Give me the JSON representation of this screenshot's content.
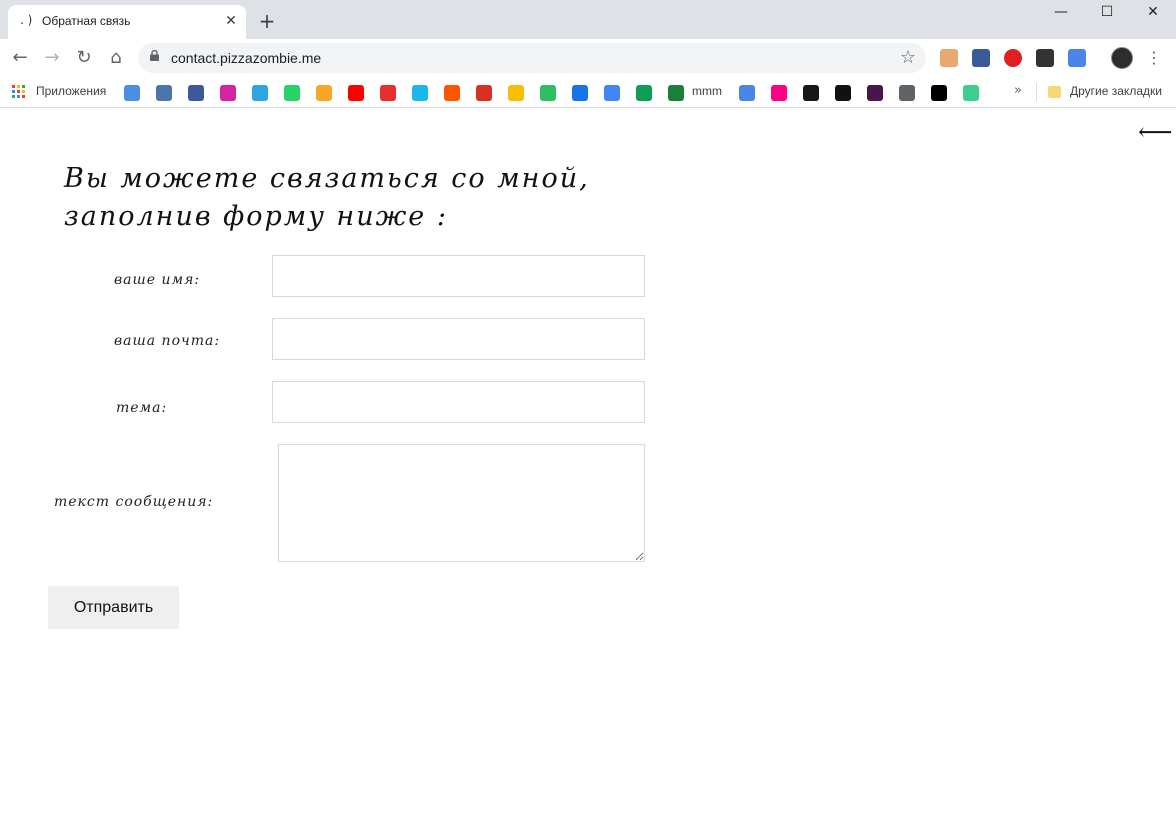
{
  "browser": {
    "tab_title": "Обратная связь",
    "tab_favicon": ". )",
    "tab_close": "✕",
    "new_tab": "+",
    "window_controls": {
      "minimize": "—",
      "maximize": "☐",
      "close": "✕"
    },
    "url": "contact.pizzazombie.me",
    "nav": {
      "back": "←",
      "forward": "→",
      "reload": "↻",
      "home": "⌂"
    },
    "star": "☆",
    "menu": "⋮",
    "extensions": [
      {
        "name": "extension-icon-1",
        "color": "#e8a86f"
      },
      {
        "name": "extension-icon-2",
        "color": "#3a5b9a"
      },
      {
        "name": "adblock-icon",
        "color": "#e02020"
      },
      {
        "name": "extension-icon-4",
        "color": "#333333"
      },
      {
        "name": "translate-icon",
        "color": "#4a86e8"
      }
    ]
  },
  "bookmarks": {
    "apps_label": "Приложения",
    "mmm_label": "mmm",
    "overflow": "»",
    "other_label": "Другие закладки",
    "icons": [
      {
        "name": "cloud-icon",
        "color": "#4a90e2"
      },
      {
        "name": "vk-icon",
        "color": "#4a76a8"
      },
      {
        "name": "facebook-icon",
        "color": "#3b5998"
      },
      {
        "name": "instagram-icon",
        "color": "#d6249f"
      },
      {
        "name": "telegram-icon",
        "color": "#2ca5e0"
      },
      {
        "name": "whatsapp-icon",
        "color": "#25d366"
      },
      {
        "name": "film-icon",
        "color": "#f5a623"
      },
      {
        "name": "youtube-icon",
        "color": "#ff0000"
      },
      {
        "name": "tiktok-icon",
        "color": "#e52e2e"
      },
      {
        "name": "vimeo-icon",
        "color": "#1ab7ea"
      },
      {
        "name": "soundcloud-icon",
        "color": "#ff5500"
      },
      {
        "name": "gmail-icon",
        "color": "#d93025"
      },
      {
        "name": "keep-icon",
        "color": "#f9bd03"
      },
      {
        "name": "evernote-icon",
        "color": "#2dbe60"
      },
      {
        "name": "calendar-icon",
        "color": "#1a73e8"
      },
      {
        "name": "docs-icon",
        "color": "#4285f4"
      },
      {
        "name": "drive-icon",
        "color": "#0f9d58"
      },
      {
        "name": "sheets-plus-icon",
        "color": "#188038"
      }
    ],
    "icons2": [
      {
        "name": "translate-bookmark-icon",
        "color": "#4a86e8"
      },
      {
        "name": "flickr-icon",
        "color": "#ff0084"
      },
      {
        "name": "github-icon",
        "color": "#181717"
      },
      {
        "name": "42-icon",
        "color": "#111111"
      },
      {
        "name": "slack-icon",
        "color": "#4a154b"
      },
      {
        "name": "badge-icon",
        "color": "#5f6368"
      },
      {
        "name": "notion-icon",
        "color": "#000000"
      },
      {
        "name": "ed-icon",
        "color": "#3ecf8e"
      }
    ]
  },
  "page": {
    "back_arrow": "⟵",
    "heading_line1": "Вы можете связаться со мной,",
    "heading_line2": "заполнив форму ниже :",
    "labels": {
      "name": "ваше имя:",
      "email": "ваша почта:",
      "subject": "тема:",
      "message": "текст сообщения:"
    },
    "values": {
      "name": "",
      "email": "",
      "subject": "",
      "message": ""
    },
    "submit_label": "Отправить"
  }
}
